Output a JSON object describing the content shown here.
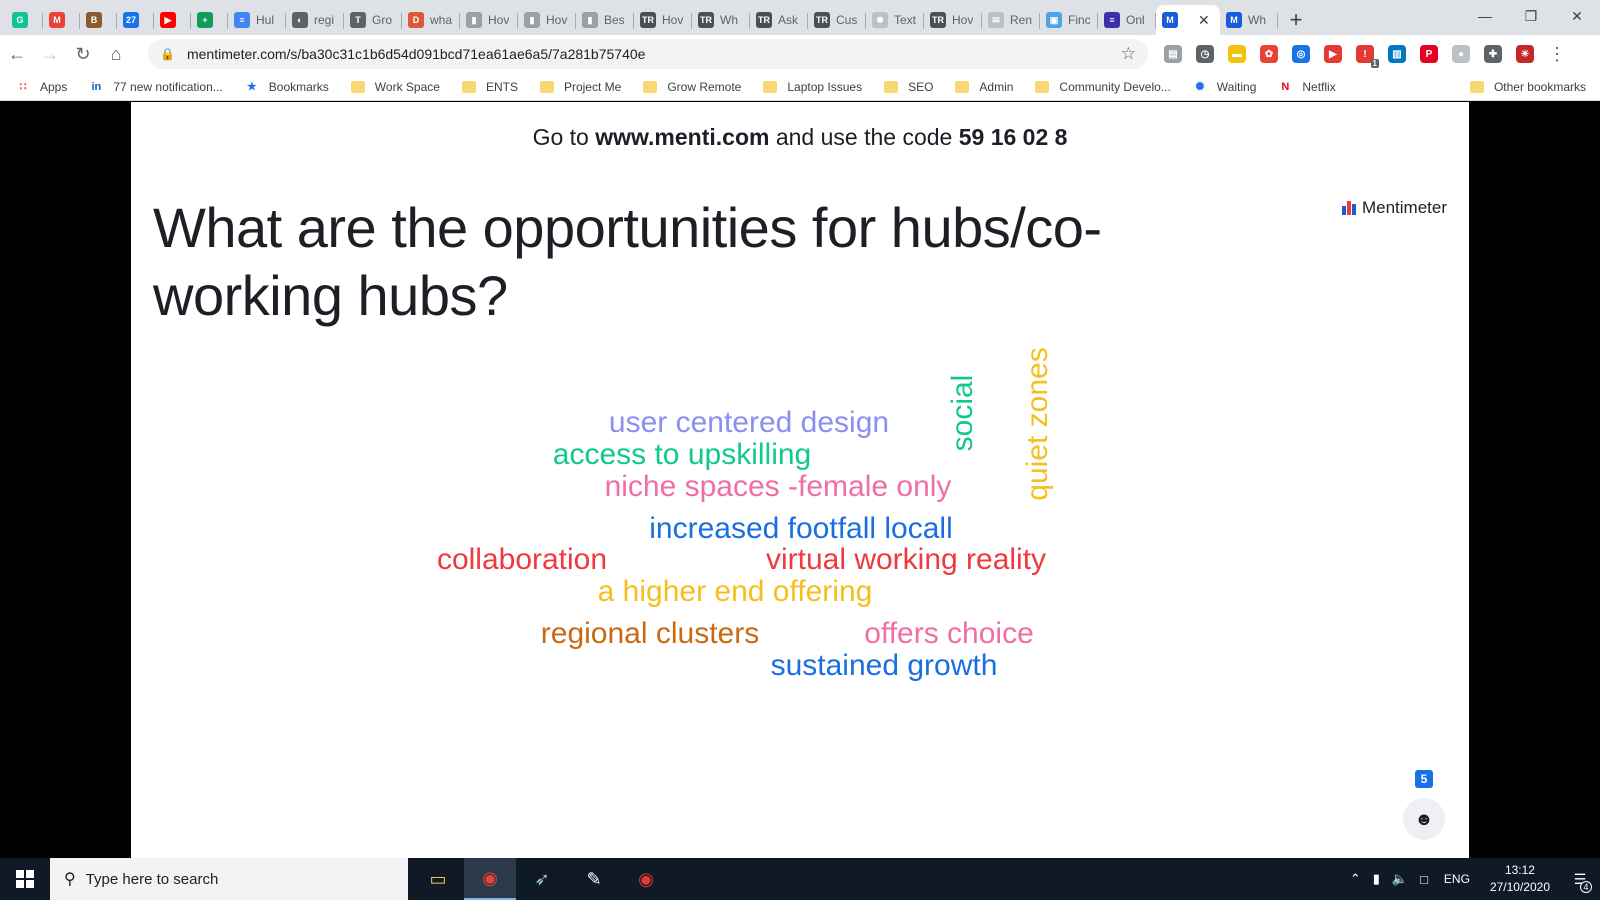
{
  "browser": {
    "tabs": [
      {
        "label": "",
        "icon": "grammarly-icon",
        "color": "#15c39a",
        "glyph": "G"
      },
      {
        "label": "",
        "icon": "gmail-icon",
        "color": "#ea4335",
        "glyph": "M"
      },
      {
        "label": "",
        "icon": "mailbox-icon",
        "color": "#8a5a2b",
        "glyph": "B"
      },
      {
        "label": "",
        "icon": "calendar-icon",
        "color": "#1a73e8",
        "glyph": "27"
      },
      {
        "label": "",
        "icon": "youtube-icon",
        "color": "#ff0000",
        "glyph": "▶"
      },
      {
        "label": "",
        "icon": "sheets-icon",
        "color": "#0f9d58",
        "glyph": "+"
      },
      {
        "label": "Hul",
        "icon": "docs-icon",
        "color": "#4285f4",
        "glyph": "≡"
      },
      {
        "label": "regi",
        "icon": "globe-icon",
        "color": "#5f6368",
        "glyph": "◐"
      },
      {
        "label": "Gro",
        "icon": "web-icon",
        "color": "#5f6368",
        "glyph": "T"
      },
      {
        "label": "wha",
        "icon": "duckduckgo-icon",
        "color": "#de5833",
        "glyph": "D"
      },
      {
        "label": "Hov",
        "icon": "page-icon",
        "color": "#9aa0a6",
        "glyph": "▮"
      },
      {
        "label": "Hov",
        "icon": "page-icon",
        "color": "#9aa0a6",
        "glyph": "▮"
      },
      {
        "label": "Bes",
        "icon": "page-icon",
        "color": "#9aa0a6",
        "glyph": "▮"
      },
      {
        "label": "Hov",
        "icon": "tr-icon",
        "color": "#4a4e55",
        "glyph": "TR"
      },
      {
        "label": "Wh",
        "icon": "tr-icon",
        "color": "#4a4e55",
        "glyph": "TR"
      },
      {
        "label": "Ask",
        "icon": "tr-icon",
        "color": "#4a4e55",
        "glyph": "TR"
      },
      {
        "label": "Cus",
        "icon": "tr-icon",
        "color": "#4a4e55",
        "glyph": "TR"
      },
      {
        "label": "Text",
        "icon": "gear-icon",
        "color": "#bdc1c6",
        "glyph": "✹"
      },
      {
        "label": "Hov",
        "icon": "tr-icon",
        "color": "#4a4e55",
        "glyph": "TR"
      },
      {
        "label": "Ren",
        "icon": "mail-icon",
        "color": "#bdc1c6",
        "glyph": "✉"
      },
      {
        "label": "Finc",
        "icon": "image-icon",
        "color": "#4fa3e0",
        "glyph": "▣"
      },
      {
        "label": "Onl",
        "icon": "onl-icon",
        "color": "#3c2fa8",
        "glyph": "≡"
      },
      {
        "label": "",
        "icon": "mentimeter-icon",
        "color": "#1a5bd6",
        "glyph": "M",
        "active": true
      },
      {
        "label": "Wh",
        "icon": "mentimeter-icon",
        "color": "#1a5bd6",
        "glyph": "M"
      }
    ],
    "url": "mentimeter.com/s/ba30c31c1b6d54d091bcd71ea61ae6a5/7a281b75740e",
    "extensions": [
      {
        "icon": "briefcase-icon",
        "color": "#9aa0a6",
        "glyph": "▤"
      },
      {
        "icon": "timer-icon",
        "color": "#5f6368",
        "glyph": "◷"
      },
      {
        "icon": "note-icon",
        "color": "#f4c20d",
        "glyph": "▬"
      },
      {
        "icon": "colorwheel-icon",
        "color": "#e94235",
        "glyph": "✿"
      },
      {
        "icon": "shield-icon",
        "color": "#1a73e8",
        "glyph": "◎"
      },
      {
        "icon": "video-icon",
        "color": "#e53935",
        "glyph": "▶"
      },
      {
        "icon": "alert-icon",
        "color": "#e53935",
        "glyph": "!",
        "badge": "1"
      },
      {
        "icon": "trello-icon",
        "color": "#0079bf",
        "glyph": "▥"
      },
      {
        "icon": "pinterest-icon",
        "color": "#e60023",
        "glyph": "P"
      },
      {
        "icon": "circle-icon",
        "color": "#bdc1c6",
        "glyph": "●"
      },
      {
        "icon": "puzzle-icon",
        "color": "#5f6368",
        "glyph": "✚"
      },
      {
        "icon": "profile-icon",
        "color": "#c62828",
        "glyph": "☀"
      }
    ],
    "bookmarks": [
      {
        "label": "Apps",
        "type": "apps"
      },
      {
        "label": "77 new notification...",
        "type": "linkedin"
      },
      {
        "label": "Bookmarks",
        "type": "star"
      },
      {
        "label": "Work Space",
        "type": "folder"
      },
      {
        "label": "ENTS",
        "type": "folder"
      },
      {
        "label": "Project Me",
        "type": "folder"
      },
      {
        "label": "Grow Remote",
        "type": "folder"
      },
      {
        "label": "Laptop Issues",
        "type": "folder"
      },
      {
        "label": "SEO",
        "type": "folder"
      },
      {
        "label": "Admin",
        "type": "folder"
      },
      {
        "label": "Community Develo...",
        "type": "folder"
      },
      {
        "label": "Waiting",
        "type": "spinner"
      },
      {
        "label": "Netflix",
        "type": "netflix"
      }
    ],
    "other_bookmarks": "Other bookmarks"
  },
  "slide": {
    "join_prefix": "Go to",
    "join_site": "www.menti.com",
    "join_middle": "and use the code",
    "join_code": "59 16 02 8",
    "brand": "Mentimeter",
    "question": "What are the opportunities for hubs/co-working hubs?",
    "participants": "5",
    "words": [
      {
        "text": "user centered design",
        "color": "#8b8ff0"
      },
      {
        "text": "access to upskilling",
        "color": "#12c98c"
      },
      {
        "text": "niche spaces -female only",
        "color": "#f06fa3"
      },
      {
        "text": "increased footfall locall",
        "color": "#1a6fe0"
      },
      {
        "text": "collaboration",
        "color": "#f0393e"
      },
      {
        "text": "virtual working reality",
        "color": "#f0393e"
      },
      {
        "text": "a higher end offering",
        "color": "#f5bf1f"
      },
      {
        "text": "regional clusters",
        "color": "#c96a12"
      },
      {
        "text": "offers choice",
        "color": "#f06fa3"
      },
      {
        "text": "sustained growth",
        "color": "#1a6fe0"
      },
      {
        "text": "social",
        "color": "#12c98c",
        "vertical": true
      },
      {
        "text": "quiet zones",
        "color": "#f5bf1f",
        "vertical": true
      }
    ]
  },
  "taskbar": {
    "search_placeholder": "Type here to search",
    "apps": [
      {
        "icon": "file-explorer-icon",
        "glyph": "▭",
        "color": "#f5c542"
      },
      {
        "icon": "chrome-icon",
        "glyph": "◉",
        "color": "#e94235",
        "active": true
      },
      {
        "icon": "feather-icon",
        "glyph": "➶",
        "color": "#9ecbe8"
      },
      {
        "icon": "sketch-icon",
        "glyph": "✎",
        "color": "#ffffff"
      },
      {
        "icon": "record-icon",
        "glyph": "◉",
        "color": "#e53935"
      }
    ],
    "language": "ENG",
    "time": "13:12",
    "date": "27/10/2020",
    "notifications": "4"
  }
}
